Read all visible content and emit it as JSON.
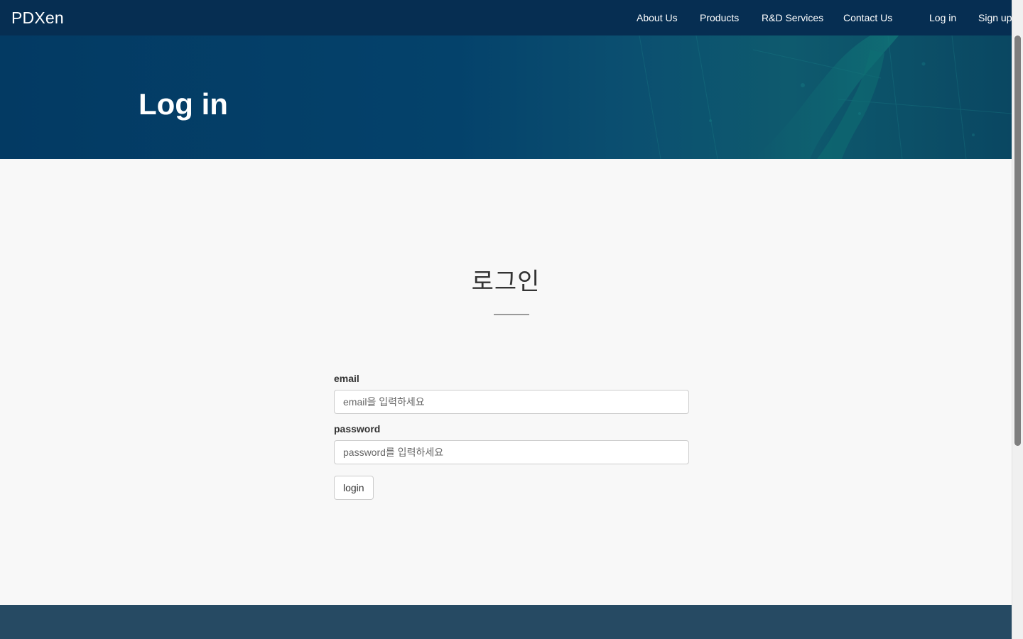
{
  "navbar": {
    "brand": "PDXen",
    "links": {
      "about": "About Us",
      "products": "Products",
      "rd": "R&D Services",
      "contact": "Contact Us",
      "login": "Log in",
      "signup": "Sign up"
    }
  },
  "hero": {
    "title": "Log in"
  },
  "main": {
    "title": "로그인",
    "form": {
      "email_label": "email",
      "email_placeholder": "email을 입력하세요",
      "password_label": "password",
      "password_placeholder": "password를 입력하세요",
      "submit_label": "login"
    }
  },
  "colors": {
    "navbar": "#062e52",
    "hero": "#04426b",
    "footer": "#264a63",
    "background": "#f8f8f8"
  }
}
